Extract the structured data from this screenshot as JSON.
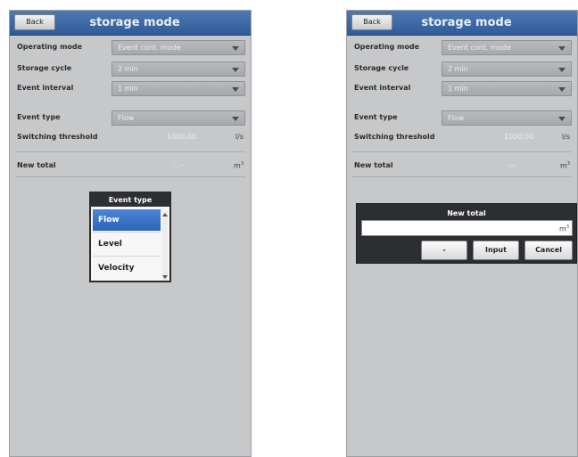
{
  "left": {
    "back_label": "Back",
    "title": "storage mode",
    "operating_mode": {
      "label": "Operating mode",
      "value": "Event cont. mode"
    },
    "storage_cycle": {
      "label": "Storage cycle",
      "value": "2 min"
    },
    "event_interval": {
      "label": "Event interval",
      "value": "1 min"
    },
    "event_type": {
      "label": "Event type",
      "value": "Flow"
    },
    "switching_threshold": {
      "label": "Switching threshold",
      "value": "1000,00",
      "unit": "l/s"
    },
    "new_total": {
      "label": "New total",
      "value": "-,--",
      "unit": "m",
      "unit_sup": "3"
    },
    "popup": {
      "title": "Event type",
      "options": [
        "Flow",
        "Level",
        "Velocity"
      ],
      "selected": "Flow"
    }
  },
  "right": {
    "back_label": "Back",
    "title": "storage mode",
    "operating_mode": {
      "label": "Operating mode",
      "value": "Event cont. mode"
    },
    "storage_cycle": {
      "label": "Storage cycle",
      "value": "2 min"
    },
    "event_interval": {
      "label": "Event interval",
      "value": "1 min"
    },
    "event_type": {
      "label": "Event type",
      "value": "Flow"
    },
    "switching_threshold": {
      "label": "Switching threshold",
      "value": "1000,00",
      "unit": "l/s"
    },
    "new_total": {
      "label": "New total",
      "value": "-,--",
      "unit": "m",
      "unit_sup": "3"
    },
    "dialog": {
      "title": "New total",
      "input_value": "",
      "unit": "m",
      "unit_sup": "3",
      "buttons": [
        "-",
        "Input",
        "Cancel"
      ]
    }
  },
  "colors": {
    "titlebar": "#3b68a6",
    "screen_bg": "#c7c8ca",
    "selected_option": "#3a72c6",
    "dialog_bg": "#2c2e31"
  }
}
